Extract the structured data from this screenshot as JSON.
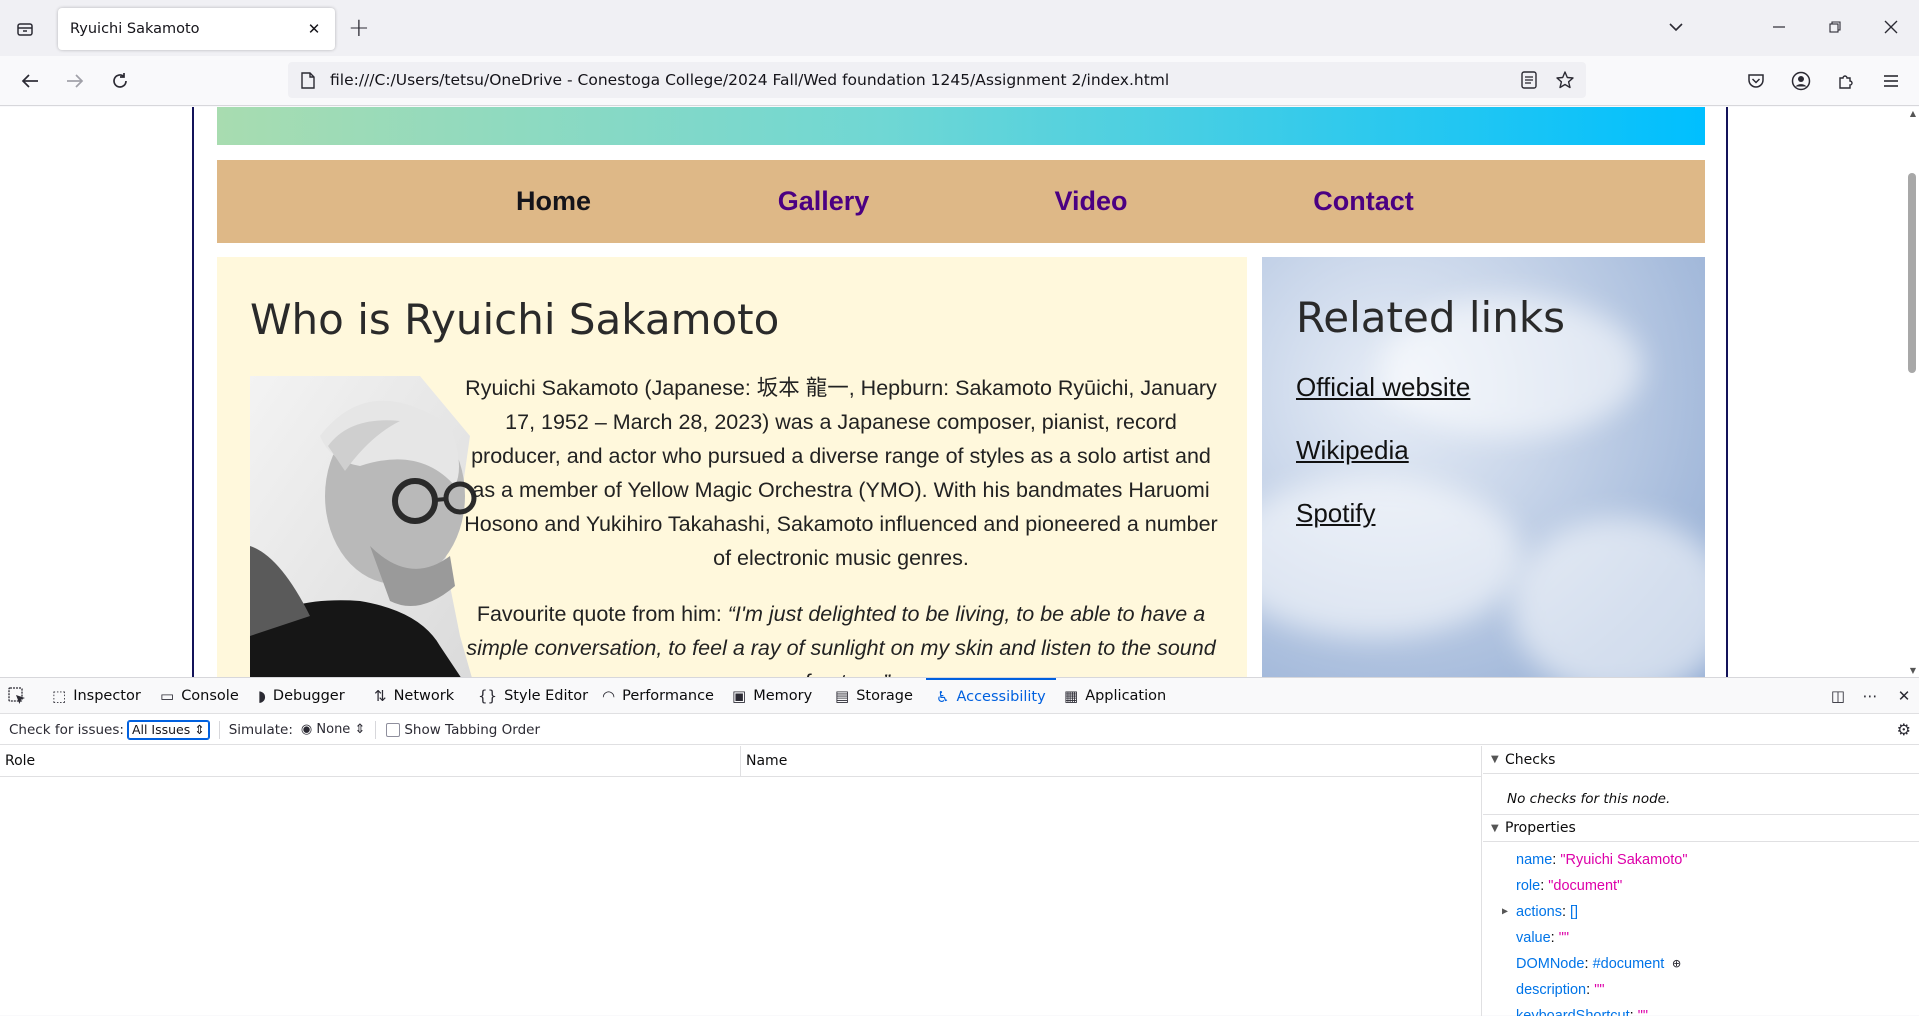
{
  "browser": {
    "tab_title": "Ryuichi Sakamoto",
    "url": "file:///C:/Users/tetsu/OneDrive - Conestoga College/2024 Fall/Wed foundation 1245/Assignment 2/index.html"
  },
  "site": {
    "nav": [
      "Home",
      "Gallery",
      "Video",
      "Contact"
    ],
    "main": {
      "heading": "Who is Ryuichi Sakamoto",
      "bio": "Ryuichi Sakamoto (Japanese: 坂本 龍一, Hepburn: Sakamoto Ryūichi, January 17, 1952 – March 28, 2023) was a Japanese composer, pianist, record producer, and actor who pursued a diverse range of styles as a solo artist and as a member of Yellow Magic Orchestra (YMO). With his bandmates Haruomi Hosono and Yukihiro Takahashi, Sakamoto influenced and pioneered a number of electronic music genres.",
      "quote_intro": "Favourite quote from him: ",
      "quote": "“I'm just delighted to be living, to be able to have a simple conversation, to feel a ray of sunlight on my skin and listen to the sound of nature.”"
    },
    "aside": {
      "heading": "Related links",
      "links": [
        "Official website",
        "Wikipedia",
        "Spotify"
      ]
    }
  },
  "devtools": {
    "tabs": [
      "Inspector",
      "Console",
      "Debugger",
      "Network",
      "Style Editor",
      "Performance",
      "Memory",
      "Storage",
      "Accessibility",
      "Application"
    ],
    "active_tab": "Accessibility",
    "toolbar": {
      "check_label": "Check for issues:",
      "check_value": "All Issues",
      "simulate_label": "Simulate:",
      "simulate_value": "None",
      "tabbing_label": "Show Tabbing Order"
    },
    "tree": {
      "col_role": "Role",
      "col_name": "Name"
    },
    "sidebar": {
      "checks_title": "Checks",
      "no_checks": "No checks for this node.",
      "properties_title": "Properties",
      "properties": [
        {
          "key": "name",
          "value": "\"Ryuichi Sakamoto\""
        },
        {
          "key": "role",
          "value": "\"document\""
        },
        {
          "key": "actions",
          "value": "[]"
        },
        {
          "key": "value",
          "value": "\"\""
        },
        {
          "key": "DOMNode",
          "value": "#document"
        },
        {
          "key": "description",
          "value": "\"\""
        },
        {
          "key": "keyboardShortcut",
          "value": "\"\""
        }
      ]
    }
  }
}
